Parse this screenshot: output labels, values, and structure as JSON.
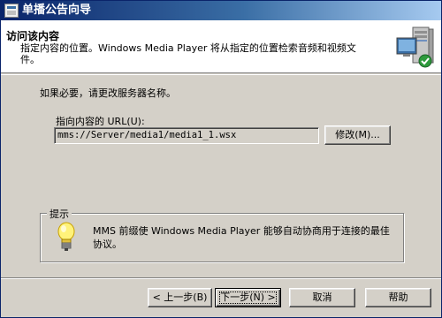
{
  "window": {
    "title": "单播公告向导"
  },
  "header": {
    "title": "访问该内容",
    "description": "指定内容的位置。Windows Media Player 将从指定的位置检索音频和视频文件。"
  },
  "body": {
    "prompt": "如果必要，请更改服务器名称。",
    "url_label": "指向内容的 URL(U):",
    "url_value": "mms://Server/media1/media1_1.wsx",
    "modify_button": "修改(M)..."
  },
  "tip": {
    "legend": "提示",
    "text": "MMS 前缀使 Windows Media Player 能够自动协商用于连接的最佳协议。"
  },
  "footer": {
    "back_button": "< 上一步(B)",
    "next_button": "下一步(N) >",
    "cancel_button": "取消",
    "help_button": "帮助"
  },
  "icons": {
    "app": "wizard-app-icon",
    "server": "media-server-icon",
    "tip": "lightbulb-icon"
  },
  "colors": {
    "titlebar_start": "#0a246a",
    "titlebar_end": "#a6caf0",
    "face": "#d4d0c8",
    "header_bg": "#ffffff"
  }
}
